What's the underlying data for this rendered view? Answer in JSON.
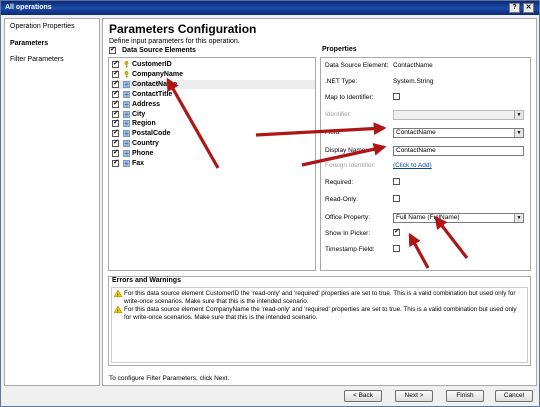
{
  "window": {
    "title": "All operations",
    "help_glyph": "?",
    "close_glyph": "✕"
  },
  "nav": {
    "items": [
      {
        "label": "Operation Properties",
        "selected": false
      },
      {
        "label": "Parameters",
        "selected": true
      },
      {
        "label": "Filter Parameters",
        "selected": false
      }
    ]
  },
  "page": {
    "title": "Parameters Configuration",
    "subtitle": "Define input parameters for this operation."
  },
  "data_source": {
    "header": "Data Source Elements",
    "items": [
      {
        "label": "CustomerID",
        "checked": true,
        "icon": "key-icon",
        "selected": false
      },
      {
        "label": "CompanyName",
        "checked": true,
        "icon": "key-icon",
        "selected": false
      },
      {
        "label": "ContactName",
        "checked": true,
        "icon": "field-icon",
        "selected": true
      },
      {
        "label": "ContactTitle",
        "checked": true,
        "icon": "field-icon",
        "selected": false
      },
      {
        "label": "Address",
        "checked": true,
        "icon": "field-icon",
        "selected": false
      },
      {
        "label": "City",
        "checked": true,
        "icon": "field-icon",
        "selected": false
      },
      {
        "label": "Region",
        "checked": true,
        "icon": "field-icon",
        "selected": false
      },
      {
        "label": "PostalCode",
        "checked": true,
        "icon": "field-icon",
        "selected": false
      },
      {
        "label": "Country",
        "checked": true,
        "icon": "field-icon",
        "selected": false
      },
      {
        "label": "Phone",
        "checked": true,
        "icon": "field-icon",
        "selected": false
      },
      {
        "label": "Fax",
        "checked": true,
        "icon": "field-icon",
        "selected": false
      }
    ]
  },
  "properties": {
    "header": "Properties",
    "data_source_element_label": "Data Source Element:",
    "data_source_element_value": "ContactName",
    "net_type_label": ".NET Type:",
    "net_type_value": "System.String",
    "map_to_identifier_label": "Map to Identifier:",
    "identifier_label": "Identifier:",
    "identifier_value": "",
    "field_label": "Field:",
    "field_value": "ContactName",
    "display_name_label": "Display Name:",
    "display_name_value": "ContactName",
    "foreign_identifier_label": "Foreign Identifier:",
    "foreign_identifier_link": "(Click to Add)",
    "required_label": "Required:",
    "read_only_label": "Read-Only:",
    "office_property_label": "Office Property:",
    "office_property_value": "Full Name (FullName)",
    "show_in_picker_label": "Show In Picker:",
    "show_in_picker_checked": true,
    "timestamp_field_label": "Timestamp Field:"
  },
  "errors": {
    "title": "Errors and Warnings",
    "warnings": [
      "For this data source element CustomerID the 'read-only' and 'required' properties are set to true. This is a valid combination but used only for write-once scenarios. Make sure that this is the intended scenario.",
      "For this data source element CompanyName the 'read-only' and 'required' properties are set to true. This is a valid combination but used only for write-once scenarios. Make sure that this is the intended scenario."
    ]
  },
  "footer_note": "To configure Filter Parameters, click Next.",
  "buttons": {
    "back": "< Back",
    "next": "Next >",
    "finish": "Finish",
    "cancel": "Cancel"
  },
  "colors": {
    "annotation_arrow": "#b01515",
    "titlebar": "#0b2a78",
    "link": "#0645ad"
  }
}
